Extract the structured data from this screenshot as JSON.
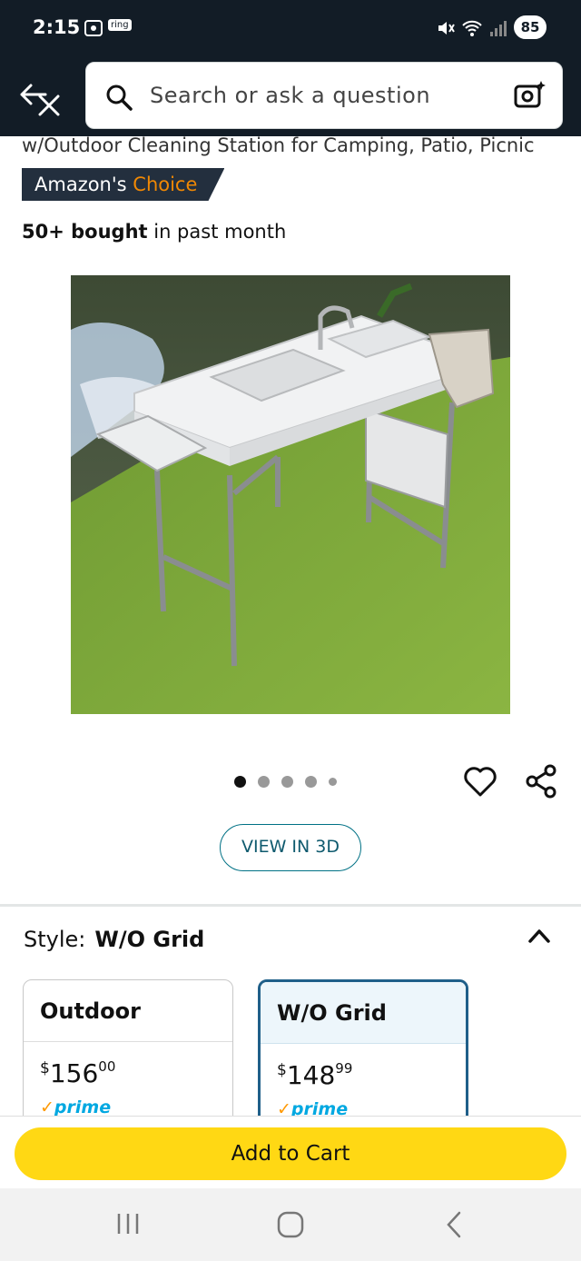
{
  "status_bar": {
    "time": "2:15",
    "ring_label": "ring",
    "battery": "85"
  },
  "search": {
    "placeholder": "Search or ask a question"
  },
  "product": {
    "title_fragment": "w/Outdoor Cleaning Station for Camping, Patio, Picnic",
    "badge_prefix": "Amazon's",
    "badge_highlight": "Choice",
    "bought_bold": "50+ bought",
    "bought_rest": " in past month"
  },
  "gallery": {
    "image_count": 5,
    "active_index": 0
  },
  "view_3d_label": "VIEW IN 3D",
  "style": {
    "label": "Style:",
    "selected": "W/O Grid",
    "options": [
      {
        "name": "Outdoor",
        "currency": "$",
        "whole": "156",
        "fraction": "00",
        "prime": "prime",
        "selected": false
      },
      {
        "name": "W/O Grid",
        "currency": "$",
        "whole": "148",
        "fraction": "99",
        "prime": "prime",
        "selected": true
      }
    ]
  },
  "add_to_cart_label": "Add to Cart",
  "colors": {
    "header_bg": "#121c26",
    "accent_orange": "#f08804",
    "cart_yellow": "#ffd814",
    "selected_border": "#1f5f89",
    "link_teal": "#007185"
  },
  "icons": [
    "screenshot-icon",
    "mute-icon",
    "wifi-icon",
    "signal-icon",
    "battery-icon",
    "back-close-icon",
    "search-icon",
    "camera-lens-icon",
    "heart-icon",
    "share-icon",
    "chevron-up-icon",
    "recents-icon",
    "home-icon",
    "back-icon"
  ]
}
